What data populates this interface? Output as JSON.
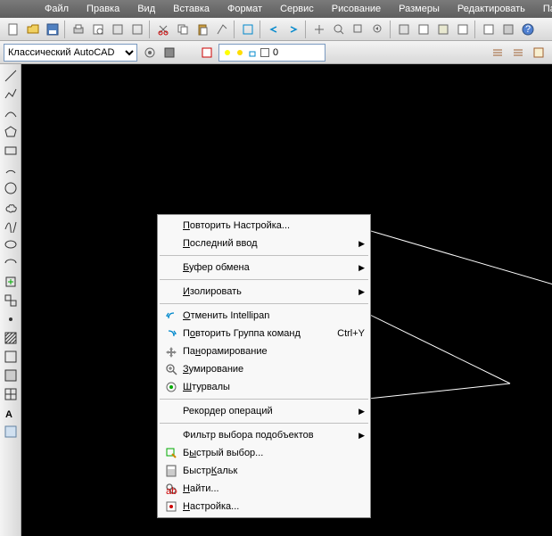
{
  "menubar": {
    "items": [
      "Файл",
      "Правка",
      "Вид",
      "Вставка",
      "Формат",
      "Сервис",
      "Рисование",
      "Размеры",
      "Редактировать",
      "Па"
    ]
  },
  "workspace": {
    "selected": "Классический AutoCAD"
  },
  "layer": {
    "name": "0"
  },
  "context_menu": {
    "items": [
      {
        "label": "Повторить Настройка...",
        "u": 0
      },
      {
        "label": "Последний ввод",
        "u": 0,
        "arrow": true
      },
      {
        "sep": true
      },
      {
        "label": "Буфер обмена",
        "u": 0,
        "arrow": true
      },
      {
        "sep": true
      },
      {
        "label": "Изолировать",
        "u": 0,
        "arrow": true
      },
      {
        "sep": true
      },
      {
        "label": "Отменить Intellipan",
        "u": 0,
        "icon": "undo"
      },
      {
        "label": "Повторить Группа команд",
        "u": 1,
        "icon": "redo",
        "shortcut": "Ctrl+Y"
      },
      {
        "label": "Панорамирование",
        "u": 2,
        "icon": "pan"
      },
      {
        "label": "Зумирование",
        "u": 0,
        "icon": "zoom"
      },
      {
        "label": "Штурвалы",
        "u": 0,
        "icon": "wheel"
      },
      {
        "sep": true
      },
      {
        "label": "Рекордер операций",
        "arrow": true
      },
      {
        "sep": true
      },
      {
        "label": "Фильтр выбора подобъектов",
        "arrow": true
      },
      {
        "label": "Быстрый выбор...",
        "u": 1,
        "icon": "quick"
      },
      {
        "label": "БыстрКальк",
        "u": 5,
        "icon": "calc"
      },
      {
        "label": "Найти...",
        "u": 0,
        "icon": "find"
      },
      {
        "label": "Настройка...",
        "u": 0,
        "icon": "settings"
      }
    ]
  }
}
